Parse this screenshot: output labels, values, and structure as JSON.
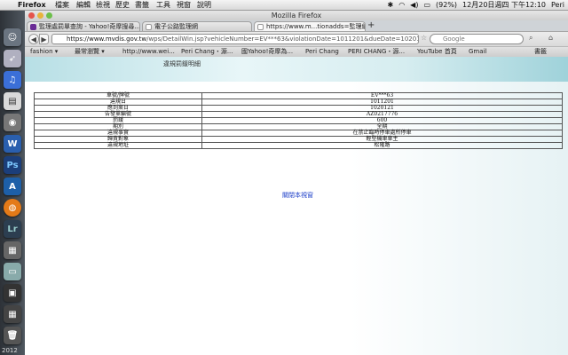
{
  "menubar": {
    "app": "Firefox",
    "items": [
      "檔案",
      "編輯",
      "檢視",
      "歷史",
      "書籤",
      "工具",
      "視窗",
      "說明"
    ],
    "battery": "(92%)",
    "clock": "12月20日週四 下午12:10",
    "user": "Peri"
  },
  "window": {
    "title": "Mozilla Firefox"
  },
  "tabs": [
    {
      "label": "監理處罰單查詢 - Yahoo!奇摩搜尋..."
    },
    {
      "label": "電子公路監理網"
    },
    {
      "label": "https://www.m...tionadds=監理網"
    }
  ],
  "navbar": {
    "url_host": "https://www.mvdis.gov.tw",
    "url_path": "/wps/DetailWin.jsp?vehicleNumber=EV***63&violationDate=1011201&dueDate=1020121&ticketNumber=",
    "search_placeholder": "Google"
  },
  "bookmarks": [
    "fashion ▾",
    "最常瀏覽 ▾",
    "http://www.wei...",
    "Peri Chang・源...",
    "國Yahoo!奇摩為...",
    "Peri Chang",
    "PERI CHANG・源...",
    "YouTube 首頁",
    "Gmail",
    "書籤"
  ],
  "page": {
    "header": "違規罰鍰明細",
    "rows": [
      {
        "label": "車號/牌號",
        "value": "EV***63"
      },
      {
        "label": "違規日",
        "value": "1011201"
      },
      {
        "label": "應到案日",
        "value": "1020121"
      },
      {
        "label": "告發單編號",
        "value": "AZ0217776"
      },
      {
        "label": "罰鍰",
        "value": "600"
      },
      {
        "label": "期別",
        "value": "全期"
      },
      {
        "label": "違規事實",
        "value": "在禁止臨時停車處所停車"
      },
      {
        "label": "歸責對象",
        "value": "輕型機車車主"
      },
      {
        "label": "違規地址",
        "value": "松隆路"
      }
    ],
    "close_link": "關閉本視窗"
  },
  "dock": {
    "year": "2012"
  },
  "colors": {
    "accent": "#1a3cc8",
    "banner": "#b7dfe5"
  }
}
